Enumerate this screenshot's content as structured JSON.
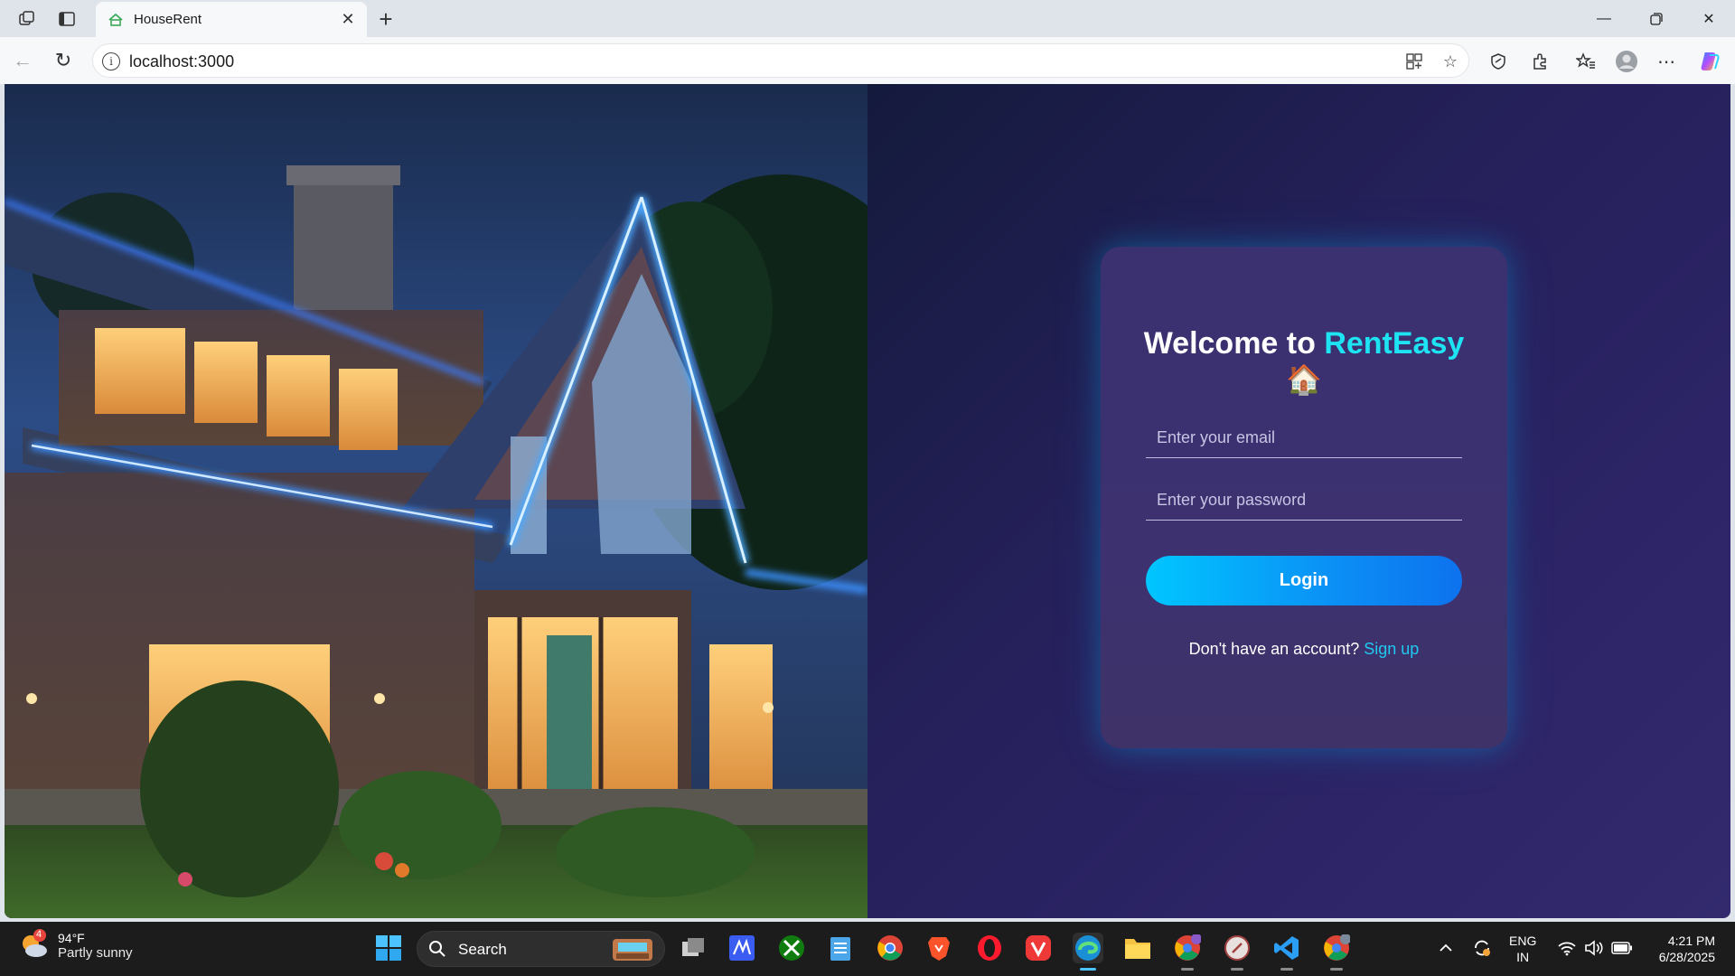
{
  "browser": {
    "tab_title": "HouseRent",
    "url": "localhost:3000",
    "icons": [
      "workspaces-icon",
      "vertical-tabs-icon",
      "favicon-icon",
      "close-tab-icon",
      "new-tab-icon",
      "minimize-icon",
      "restore-icon",
      "close-window-icon",
      "back-icon",
      "refresh-icon",
      "site-info-icon",
      "app-available-icon",
      "favorite-star-icon",
      "browser-essentials-icon",
      "extensions-icon",
      "favorites-icon",
      "profile-icon",
      "more-icon",
      "copilot-icon"
    ]
  },
  "login": {
    "title_prefix": "Welcome to ",
    "brand": "RentEasy",
    "emoji": "🏠",
    "email_placeholder": "Enter your email",
    "password_placeholder": "Enter your password",
    "login_label": "Login",
    "signup_prompt": "Don't have an account?",
    "signup_link": "Sign up",
    "brand_color": "#1ee3f2",
    "button_gradient": [
      "#00c6ff",
      "#0d72ee"
    ]
  },
  "taskbar": {
    "weather_temp": "94°F",
    "weather_desc": "Partly sunny",
    "weather_badge": "4",
    "search_label": "Search",
    "lang_line1": "ENG",
    "lang_line2": "IN",
    "time": "4:21 PM",
    "date": "6/28/2025",
    "apps": [
      "windows-start",
      "search",
      "task-view",
      "visual-studio",
      "xbox",
      "notepad",
      "chrome",
      "brave",
      "opera",
      "vivaldi",
      "edge",
      "file-explorer",
      "chrome-profile",
      "xmind",
      "vscode",
      "chrome-profile-2"
    ]
  }
}
